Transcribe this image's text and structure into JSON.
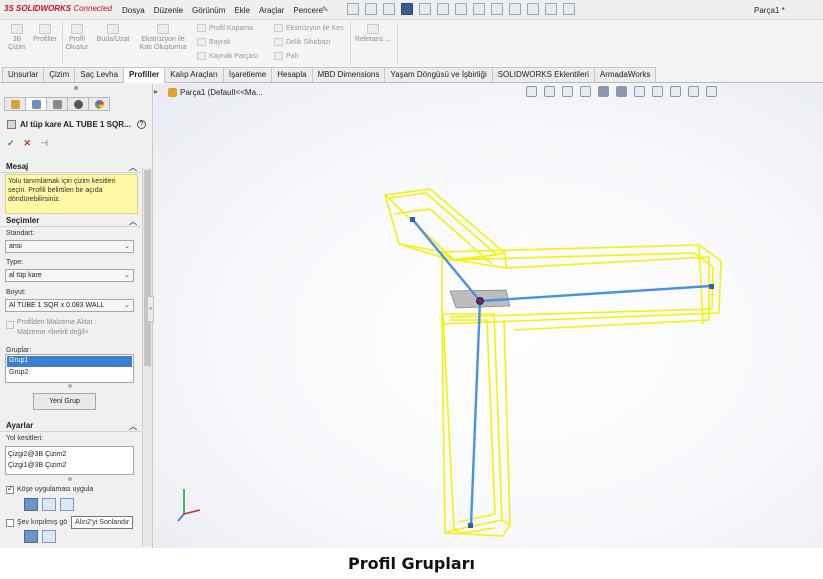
{
  "app": {
    "logo_brand": "3S SOLIDWORKS",
    "logo_suffix": "Connected",
    "document_title": "Parça1 *"
  },
  "menu": [
    "Dosya",
    "Düzenle",
    "Görünüm",
    "Ekle",
    "Araçlar",
    "Pencere"
  ],
  "ribbon": {
    "big_buttons": [
      {
        "label_line1": "3B",
        "label_line2": "Çizim"
      },
      {
        "label_line1": "Profiller",
        "label_line2": ""
      },
      {
        "label_line1": "Profil",
        "label_line2": "Oluştur"
      },
      {
        "label_line1": "Buda/Uzat",
        "label_line2": ""
      },
      {
        "label_line1": "Ekstrüzyon ile",
        "label_line2": "Katı Oluşturma"
      }
    ],
    "small_buttons_col1": [
      "Profil Kapama",
      "Bayrak",
      "Kaynak Parçası"
    ],
    "small_buttons_col2": [
      "Ekstrüzyon ile Kes",
      "Delik Sihirbazı",
      "Pah"
    ],
    "reference_label": "Referans ..."
  },
  "tabs": [
    "Unsurlar",
    "Çizim",
    "Saç Levha",
    "Profiller",
    "Kalıp Araçları",
    "İşaretleme",
    "Hesapla",
    "MBD Dimensions",
    "Yaşam Döngüsü ve İşbirliği",
    "SOLIDWORKS Eklentileri",
    "ArmadaWorks"
  ],
  "active_tab": "Profiller",
  "property_manager": {
    "title": "Al tüp kare AL TUBE 1 SQR...",
    "help": "?",
    "message_section": "Mesaj",
    "message_text": "Yolu tanımlamak için çizim kesitleri seçin. Profili belirtilen bir açıda döndürebilirsiniz.",
    "selections_section": "Seçimler",
    "standard_label": "Standart:",
    "standard_value": "ansi",
    "type_label": "Type:",
    "type_value": "al tüp kare",
    "size_label": "Boyut:",
    "size_value": "Al TUBE 1 SQR x 0.083 WALL",
    "material_checkbox_line1": "Profilden Malzeme Aktar :",
    "material_checkbox_line2": "Malzeme <belirli değil>",
    "groups_label": "Gruplar:",
    "groups": [
      "Grup1",
      "Grup2"
    ],
    "selected_group": "Grup1",
    "new_group_button": "Yeni Grup",
    "settings_section": "Ayarlar",
    "path_segments_label": "Yol kesitleri:",
    "path_segments": [
      "Çizgi2@3B Çizim2",
      "Çizgi1@3B Çizim2"
    ],
    "apply_corner_label": "Köşe uygulaması uygula",
    "apply_corner_checked": true,
    "trimmed_label": "Şev kırpılmış gö",
    "trimmed_checked": false,
    "tooltip": "Alın2'yi Sonlandır"
  },
  "feature_tree": {
    "root": "Parça1  (Default<<Ma..."
  },
  "colors": {
    "profile_outline": "#f5f20a",
    "sketch_line": "#4a90e6",
    "accent_red": "#c8102e",
    "selection_blue": "#3b7fd4",
    "message_bg": "#fff8a6"
  },
  "caption": "Profil Grupları"
}
